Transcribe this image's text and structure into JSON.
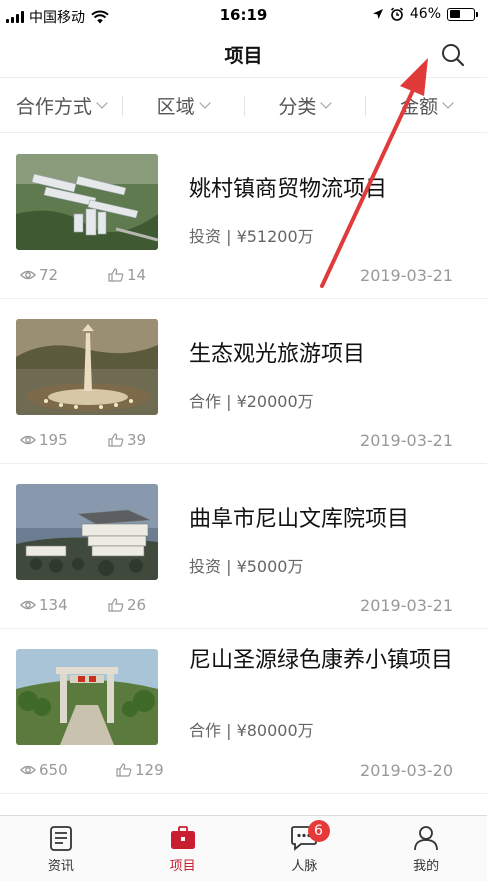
{
  "status_bar": {
    "carrier": "中国移动",
    "time": "16:19",
    "battery_pct": "46%",
    "battery_level": 0.46
  },
  "nav": {
    "title": "项目",
    "search_icon": "search-icon"
  },
  "filters": [
    {
      "label": "合作方式"
    },
    {
      "label": "区域"
    },
    {
      "label": "分类"
    },
    {
      "label": "金额"
    }
  ],
  "projects": [
    {
      "title": "姚村镇商贸物流项目",
      "meta": "投资 | ¥51200万",
      "views": "72",
      "likes": "14",
      "date": "2019-03-21"
    },
    {
      "title": "生态观光旅游项目",
      "meta": "合作 | ¥20000万",
      "views": "195",
      "likes": "39",
      "date": "2019-03-21"
    },
    {
      "title": "曲阜市尼山文库院项目",
      "meta": "投资 | ¥5000万",
      "views": "134",
      "likes": "26",
      "date": "2019-03-21"
    },
    {
      "title": "尼山圣源绿色康养小镇项目",
      "meta": "合作 | ¥80000万",
      "views": "650",
      "likes": "129",
      "date": "2019-03-20"
    }
  ],
  "tabs": [
    {
      "label": "资讯",
      "icon": "news-icon"
    },
    {
      "label": "项目",
      "icon": "briefcase-icon",
      "active": true
    },
    {
      "label": "人脉",
      "icon": "chat-icon",
      "badge": "6"
    },
    {
      "label": "我的",
      "icon": "person-icon"
    }
  ],
  "colors": {
    "accent": "#c81e2f",
    "badge": "#e63a3a",
    "arrow": "#e03a3a"
  }
}
